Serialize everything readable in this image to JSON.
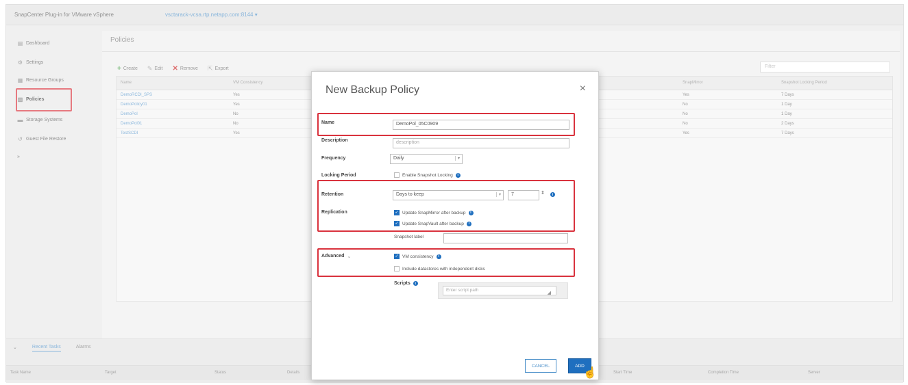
{
  "app": {
    "title": "SnapCenter Plug-in for VMware vSphere",
    "host": "vsctarack-vcsa.rtp.netapp.com:8144 ▾"
  },
  "sidebar": {
    "items": [
      {
        "label": "Dashboard",
        "icon": "dashboard-icon"
      },
      {
        "label": "Settings",
        "icon": "settings-icon"
      },
      {
        "label": "Resource Groups",
        "icon": "resource-groups-icon"
      },
      {
        "label": "Policies",
        "icon": "policies-icon"
      },
      {
        "label": "Storage Systems",
        "icon": "storage-icon"
      },
      {
        "label": "Guest File Restore",
        "icon": "restore-icon"
      },
      {
        "label": "»",
        "icon": ""
      }
    ]
  },
  "main": {
    "title": "Policies",
    "toolbar": {
      "create": "Create",
      "edit": "Edit",
      "remove": "Remove",
      "export": "Export"
    },
    "filter_placeholder": "Filter",
    "columns": [
      "Name",
      "VM Consistency",
      "SnapMirror",
      "Snapshot Locking Period"
    ],
    "rows": [
      {
        "name": "DemoRCDI_SPS",
        "vm": "Yes",
        "snapmirror": "Yes",
        "locking": "7 Days"
      },
      {
        "name": "DemoPolicy01",
        "vm": "Yes",
        "snapmirror": "No",
        "locking": "1 Day"
      },
      {
        "name": "DemoPol",
        "vm": "No",
        "snapmirror": "No",
        "locking": "1 Day"
      },
      {
        "name": "DemoPol01",
        "vm": "No",
        "snapmirror": "No",
        "locking": "2 Days"
      },
      {
        "name": "TestSCDI",
        "vm": "Yes",
        "snapmirror": "Yes",
        "locking": "7 Days"
      }
    ]
  },
  "bottom": {
    "tabs": [
      "Recent Tasks",
      "Alarms"
    ],
    "columns": [
      "Task Name",
      "Target",
      "Status",
      "Details",
      "Start Time",
      "Completion Time",
      "Server"
    ]
  },
  "modal": {
    "title": "New Backup Policy",
    "close": "×",
    "fields": {
      "name_label": "Name",
      "name_value": "DemoPol_05C0909",
      "description_label": "Description",
      "description_placeholder": "description",
      "frequency_label": "Frequency",
      "frequency_value": "Daily",
      "locking_label": "Locking Period",
      "locking_checkbox": "Enable Snapshot Locking",
      "retention_label": "Retention",
      "retention_value": "Days to keep",
      "retention_count": "7",
      "replication_label": "Replication",
      "replication_snapmirror": "Update SnapMirror after backup",
      "replication_snapvault": "Update SnapVault after backup",
      "snapshot_label_label": "Snapshot label",
      "advanced_label": "Advanced",
      "vm_consistency": "VM consistency",
      "include_datastores": "Include datastores with independent disks",
      "scripts_label": "Scripts",
      "scripts_placeholder": "Enter script path"
    },
    "buttons": {
      "cancel": "CANCEL",
      "add": "ADD"
    }
  },
  "colors": {
    "accent": "#1f6fbf",
    "highlight": "#d9323d"
  }
}
